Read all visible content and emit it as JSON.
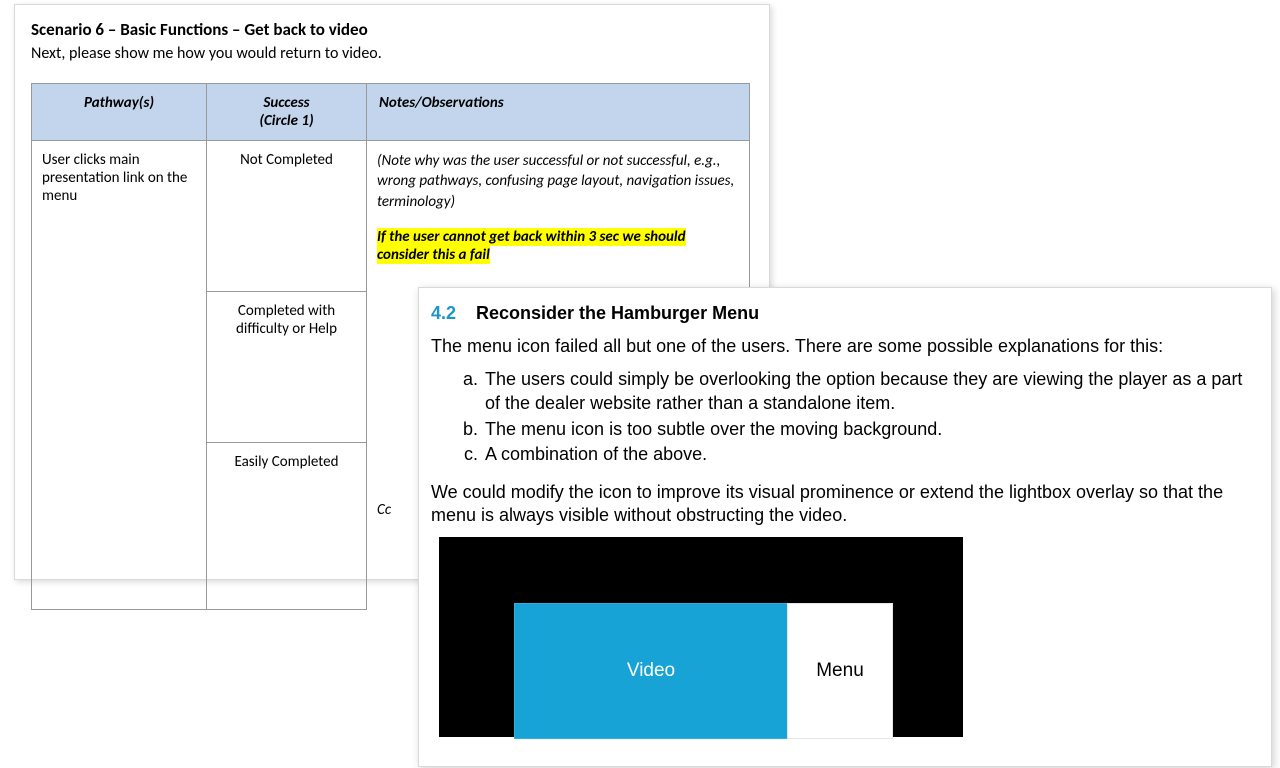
{
  "back": {
    "title": "Scenario 6 – Basic Functions – Get back to video",
    "subtitle": "Next, please show me how you would return to video.",
    "headers": {
      "pathways": "Pathway(s)",
      "success_top": "Success",
      "success_sub": "(Circle 1)",
      "notes": "Notes/Observations"
    },
    "pathway": "User clicks main presentation link on the menu",
    "success_rows": {
      "r1": "Not Completed",
      "r2": "Completed with difficulty or Help",
      "r3": "Easily Completed"
    },
    "notes_ital": "(Note why was the user successful or not successful, e.g., wrong pathways, confusing page layout, navigation issues, terminology)",
    "notes_highlight": "If the user cannot get back within 3 sec we should consider this a fail",
    "notes_tail": "Cc"
  },
  "front": {
    "num": "4.2",
    "title": "Reconsider the Hamburger Menu",
    "intro": "The menu icon failed all but one of the users. There are some possible explanations for this:",
    "items": {
      "a": "The users could simply be overlooking the option because they are viewing the player as a part of the dealer website rather than a standalone item.",
      "b": "The menu icon is too subtle over the moving background.",
      "c": "A combination of the above."
    },
    "para2": "We could modify the icon to improve its visual prominence or extend the lightbox overlay so that the menu is always visible without obstructing the video.",
    "mock": {
      "video": "Video",
      "menu": "Menu"
    }
  }
}
